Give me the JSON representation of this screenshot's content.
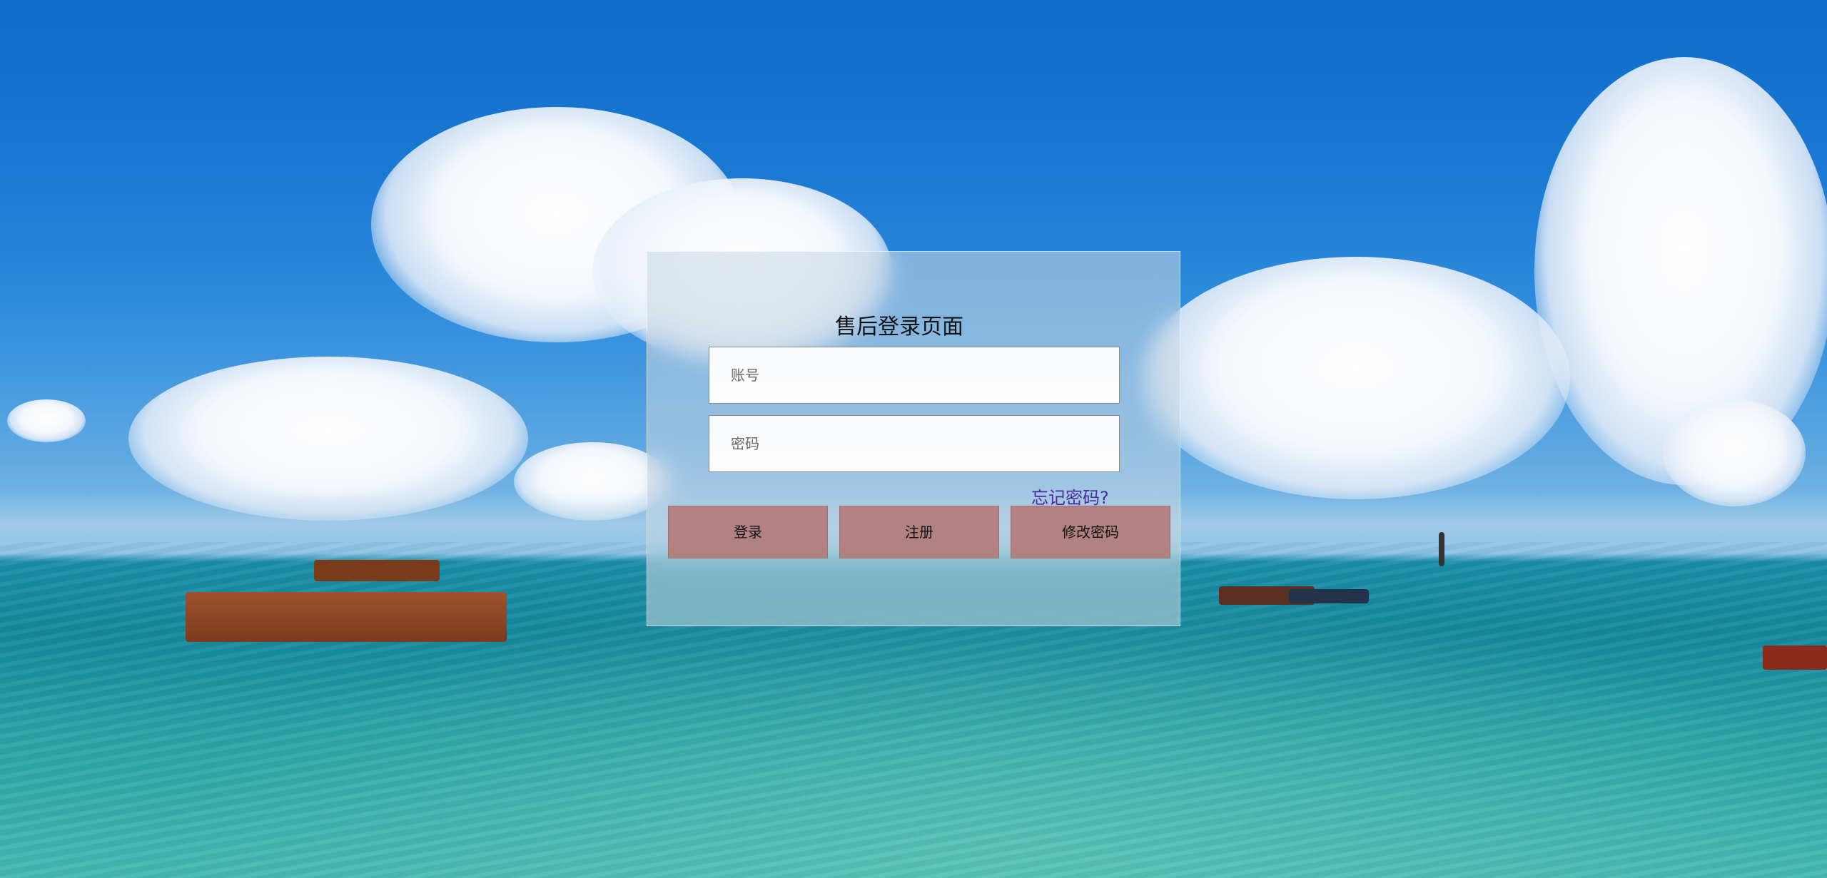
{
  "login": {
    "title": "售后登录页面",
    "account_placeholder": "账号",
    "password_placeholder": "密码",
    "forgot_label": "忘记密码?",
    "login_label": "登录",
    "register_label": "注册",
    "change_password_label": "修改密码"
  },
  "colors": {
    "button_bg": "#b27873",
    "forgot_link": "#4a2aa0",
    "sky": "#1878d2",
    "sea": "#15889c"
  },
  "background": {
    "scene": "sky-clouds-sea-boats"
  }
}
